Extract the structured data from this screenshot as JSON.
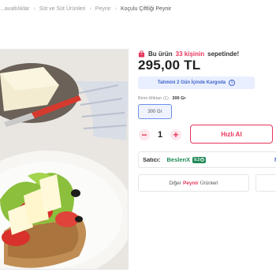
{
  "breadcrumb": {
    "items": [
      "...avaltılıklar",
      "Süt ve Süt Ürünleri",
      "Peynir",
      "Koçulu Çiftliği Peynir"
    ]
  },
  "product": {
    "cart_note_prefix": "Bu ürün",
    "cart_note_count": "33 kişinin",
    "cart_note_suffix": "sepetinde!",
    "price": "295,00 TL",
    "shipping_text": "Tahmini 2 Gün İçinde Kargoda",
    "unit_label": "Birim Miktarı (1) :",
    "unit_value": "300 Gr",
    "size_option": "300 Gr",
    "quantity": "1",
    "minus": "−",
    "plus": "+",
    "buy_now": "Hızlı Al"
  },
  "seller": {
    "label": "Satıcı:",
    "name": "BeslenX",
    "rating": "9.3",
    "more": "M"
  },
  "other_products": {
    "prefix": "Diğer",
    "brand": "Peynir",
    "suffix": "Ürünleri"
  },
  "colors": {
    "accent": "#e8345a",
    "blue": "#3f63c9",
    "seller_green": "#1f8a57"
  }
}
